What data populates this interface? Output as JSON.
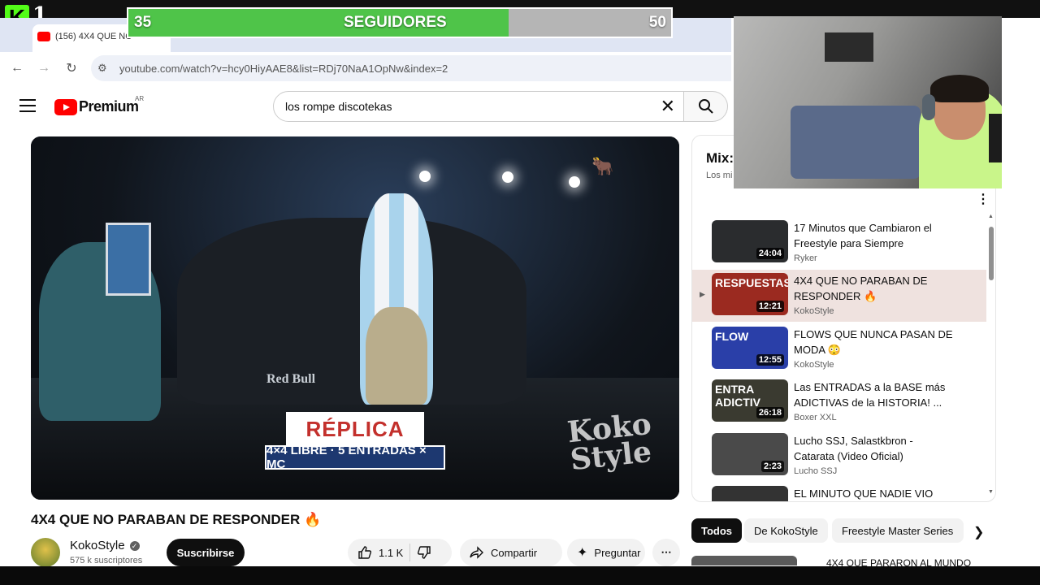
{
  "overlay": {
    "kick_logo": "K",
    "kick_number": "1",
    "goal": {
      "current": "35",
      "label": "SEGUIDORES",
      "target": "50",
      "progress": 0.7
    }
  },
  "browser": {
    "tab_title": "(156) 4X4 QUE NO",
    "url": "youtube.com/watch?v=hcy0HiyAAE8&list=RDj70NaA1OpNw&index=2",
    "back_icon": "back-arrow-icon",
    "forward_icon": "forward-arrow-icon",
    "reload_icon": "reload-icon"
  },
  "youtube": {
    "brand": "Premium",
    "region": "AR",
    "search_value": "los rompe discotekas"
  },
  "player": {
    "lower_third_top": "RÉPLICA",
    "lower_third_bottom": "4×4 LIBRE · 5 ENTRADAS × MC",
    "watermark_line1": "Koko",
    "watermark_line2": "Style",
    "stage_sign": "Red Bull"
  },
  "video": {
    "title": "4X4 QUE NO PARABAN DE RESPONDER 🔥",
    "channel": "KokoStyle",
    "subscribers": "575 k suscriptores",
    "subscribe_label": "Suscribirse",
    "likes": "1.1 K",
    "share_label": "Compartir",
    "ask_label": "Preguntar"
  },
  "mix": {
    "title": "Mix:",
    "subtitle": "Los mi",
    "items": [
      {
        "title": "17 Minutos que Cambiaron el Freestyle para Siempre",
        "channel": "Ryker",
        "duration": "24:04",
        "thumb_text": "",
        "thumb_color": "#2a2c2e",
        "active": false
      },
      {
        "title": "4X4 QUE NO PARABAN DE RESPONDER 🔥",
        "channel": "KokoStyle",
        "duration": "12:21",
        "thumb_text": "RESPUESTAS",
        "thumb_color": "#9b2a20",
        "active": true
      },
      {
        "title": "FLOWS QUE NUNCA PASAN DE MODA 😳",
        "channel": "KokoStyle",
        "duration": "12:55",
        "thumb_text": "FLOW",
        "thumb_color": "#2a3fa8",
        "active": false
      },
      {
        "title": "Las ENTRADAS a la BASE más ADICTIVAS de la HISTORIA! ...",
        "channel": "Boxer XXL",
        "duration": "26:18",
        "thumb_text": "ENTRA ADICTIV",
        "thumb_color": "#3a3a30",
        "active": false
      },
      {
        "title": "Lucho SSJ, Salastkbron - Catarata (Video Oficial)",
        "channel": "Lucho SSJ",
        "duration": "2:23",
        "thumb_text": "",
        "thumb_color": "#4a4a4a",
        "active": false
      },
      {
        "title": "EL MINUTO QUE NADIE VIO",
        "channel": "",
        "duration": "",
        "thumb_text": "",
        "thumb_color": "#333333",
        "active": false
      }
    ]
  },
  "chips": [
    "Todos",
    "De KokoStyle",
    "Freestyle Master Series"
  ],
  "up_next_title": "4X4 QUE PARARON AL MUNDO"
}
